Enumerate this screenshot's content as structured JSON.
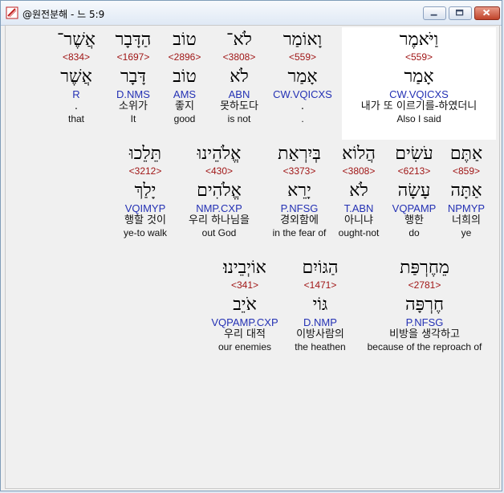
{
  "window": {
    "title": "@원전분해 - 느 5:9"
  },
  "rows": [
    {
      "words": [
        {
          "hebrew": "אֲשֶׁר־",
          "strong": "<834>",
          "lemma": "אֲשֶׁר",
          "morph": "R",
          "korean": ".",
          "english": "that"
        },
        {
          "hebrew": "הַדָּבָר",
          "strong": "<1697>",
          "lemma": "דָּבָר",
          "morph": "D.NMS",
          "korean": "소위가",
          "english": "It"
        },
        {
          "hebrew": "טוֹב",
          "strong": "<2896>",
          "lemma": "טוֹב",
          "morph": "AMS",
          "korean": "좋지",
          "english": "good"
        },
        {
          "hebrew": "לֹא־",
          "strong": "<3808>",
          "lemma": "לֹא",
          "morph": "ABN",
          "korean": "못하도다",
          "english": "is not"
        },
        {
          "hebrew": "וָאוֹמַר",
          "strong": "<559>",
          "lemma": "אָמַר",
          "morph": "CW.VQICXS",
          "korean": ".",
          "english": "."
        },
        {
          "hebrew": "וַיֹּאמֶר",
          "strong": "<559>",
          "lemma": "אָמַר",
          "morph": "CW.VQICXS",
          "korean": "내가 또 이르기를-하였더니",
          "english": "Also I said"
        }
      ]
    },
    {
      "words": [
        {
          "hebrew": "תֵּלֵכוּ",
          "strong": "<3212>",
          "lemma": "יָלַךְ",
          "morph": "VQIMYP",
          "korean": "행할 것이",
          "english": "ye-to walk"
        },
        {
          "hebrew": "אֱלֹהֵינוּ",
          "strong": "<430>",
          "lemma": "אֱלֹהִים",
          "morph": "NMP.CXP",
          "korean": "우리 하나님을",
          "english": "out God"
        },
        {
          "hebrew": "בְּיִרְאַת",
          "strong": "<3373>",
          "lemma": "יָרֵא",
          "morph": "P.NFSG",
          "korean": "경외함에",
          "english": "in the fear of"
        },
        {
          "hebrew": "הֲלוֹא",
          "strong": "<3808>",
          "lemma": "לֹא",
          "morph": "T.ABN",
          "korean": "아니냐",
          "english": "ought-not"
        },
        {
          "hebrew": "עֹשִׂים",
          "strong": "<6213>",
          "lemma": "עָשָׂה",
          "morph": "VQPAMP",
          "korean": "행한",
          "english": "do"
        },
        {
          "hebrew": "אַתֶּם",
          "strong": "<859>",
          "lemma": "אַתָּה",
          "morph": "NPMYP",
          "korean": "너희의",
          "english": "ye"
        }
      ]
    },
    {
      "words": [
        {
          "hebrew": "אוֹיְבֵינוּ׃",
          "strong": "<341>",
          "lemma": "אֹיֵב",
          "morph": "VQPAMP.CXP",
          "korean": "우리 대적",
          "english": "our enemies"
        },
        {
          "hebrew": "הַגּוֹיִם",
          "strong": "<1471>",
          "lemma": "גּוֹי",
          "morph": "D.NMP",
          "korean": "이방사람의",
          "english": "the heathen"
        },
        {
          "hebrew": "מֵחֶרְפַּת",
          "strong": "<2781>",
          "lemma": "חֶרְפָּה",
          "morph": "P.NFSG",
          "korean": "비방을 생각하고",
          "english": "because of the reproach of"
        }
      ]
    }
  ]
}
